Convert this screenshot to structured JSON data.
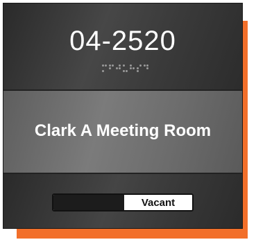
{
  "sign": {
    "room_number": "04-2520",
    "braille_cells": [
      [
        1,
        0,
        1,
        1,
        0,
        0
      ],
      [
        1,
        1,
        0,
        1,
        0,
        0
      ],
      [
        0,
        1,
        0,
        1,
        1,
        0
      ],
      [
        1,
        0,
        1,
        0,
        0,
        1
      ],
      [
        1,
        1,
        0,
        0,
        1,
        0
      ],
      [
        0,
        1,
        1,
        1,
        0,
        0
      ],
      [
        1,
        0,
        0,
        1,
        1,
        0
      ]
    ],
    "room_name": "Clark A Meeting Room",
    "status_slider": {
      "label": "Vacant",
      "state": "vacant"
    }
  },
  "colors": {
    "accent_backplate": "#f26f2a",
    "sign_dark": "#3a3a3a",
    "sign_mid": "#6c6c6c",
    "text": "#ffffff"
  }
}
